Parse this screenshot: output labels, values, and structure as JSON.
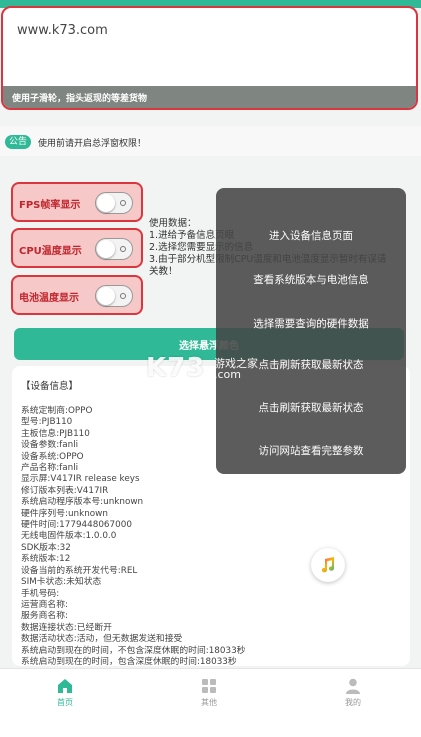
{
  "url_input": {
    "value": "www.k73.com",
    "hint": "使用子滑轮，指头返现的等差货物"
  },
  "notice": {
    "badge": "公告",
    "text": "使用前请开启总浮窗权限！"
  },
  "toggles": [
    {
      "label": "FPS帧率显示",
      "on": false
    },
    {
      "label": "CPU温度显示",
      "on": false
    },
    {
      "label": "电池温度显示",
      "on": false
    }
  ],
  "usage": {
    "title": "使用数据：",
    "lines": [
      "1.进给予备信息页眼",
      "2.选择您需要显示的信息",
      "3.由于部分机型限制CPU温度和电池温度显示暂时有误请",
      "关教！"
    ]
  },
  "color_button": {
    "label": "选择悬浮颜色"
  },
  "device_info": {
    "title": "【设备信息】",
    "lines": [
      "系统定制商:OPPO",
      "型号:PJB110",
      "主板信息:PJB110",
      "设备参数:fanli",
      "设备系统:OPPO",
      "产品名称:fanli",
      "显示屏:V417IR release keys",
      "修订版本列表:V417IR",
      "系统启动程序版本号:unknown",
      "硬件序列号:unknown",
      "硬件时间:1779448067000",
      "无线电固件版本:1.0.0.0",
      "SDK版本:32",
      "系统版本:12",
      "设备当前的系统开发代号:REL",
      "SIM卡状态:未知状态",
      "手机号码:",
      "运营商名称:",
      "服务商名称:",
      "数据连接状态:已经断开",
      "数据活动状态:活动，但无数据发送和接受",
      "系统启动到现在的时间，不包含深度休眠的时间:18033秒",
      "系统启动到现在的时间，包含深度休眠的时间:18033秒"
    ]
  },
  "menu": {
    "items": [
      "进入设备信息页面",
      "查看系统版本与电池信息",
      "选择需要查询的硬件数据",
      "点击刷新获取最新状态",
      "点击刷新获取最新状态",
      "访问网站查看完整参数"
    ]
  },
  "watermark": {
    "brand": "K73",
    "site": "游戏之家",
    "domain": ".com"
  },
  "bottom_nav": [
    {
      "label": "首页",
      "active": true
    },
    {
      "label": "其他",
      "active": false
    },
    {
      "label": "我的",
      "active": false
    }
  ],
  "colors": {
    "accent": "#2fb996",
    "alert": "#d9363e",
    "toggle_bg": "#f6c8c8"
  }
}
